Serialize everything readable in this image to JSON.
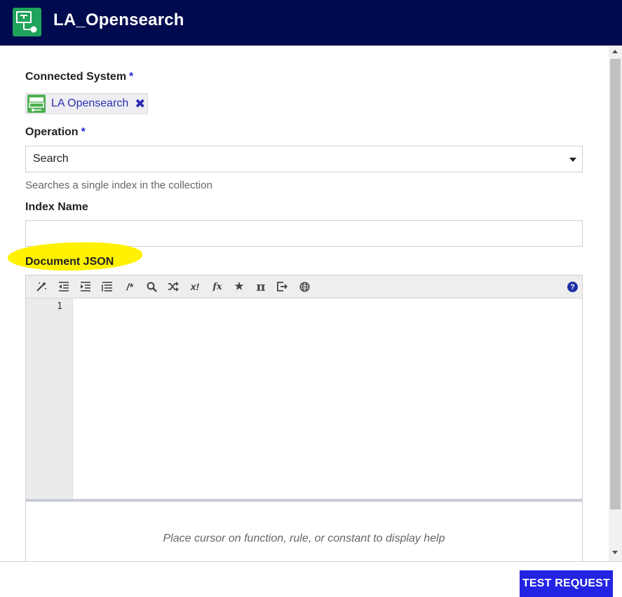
{
  "header": {
    "title": "LA_Opensearch"
  },
  "form": {
    "connected_system": {
      "label": "Connected System",
      "required_mark": "*",
      "chip_label": "LA Opensearch",
      "remove_glyph": "✖"
    },
    "operation": {
      "label": "Operation",
      "required_mark": "*",
      "selected": "Search",
      "description": "Searches a single index in the collection"
    },
    "index_name": {
      "label": "Index Name",
      "value": ""
    },
    "document_json": {
      "label": "Document JSON",
      "toolbar": [
        {
          "name": "format-icon"
        },
        {
          "name": "outdent-icon"
        },
        {
          "name": "indent-icon"
        },
        {
          "name": "list-icon"
        },
        {
          "name": "comment-icon",
          "glyph": "/*"
        },
        {
          "name": "search-icon"
        },
        {
          "name": "shuffle-icon"
        },
        {
          "name": "test-icon",
          "glyph": "x!"
        },
        {
          "name": "function-icon",
          "glyph": "fx"
        },
        {
          "name": "star-icon",
          "glyph": "★"
        },
        {
          "name": "pi-icon",
          "glyph": "π"
        },
        {
          "name": "export-icon"
        },
        {
          "name": "globe-icon"
        }
      ],
      "help_glyph": "?",
      "line_numbers": [
        "1"
      ],
      "help_message": "Place cursor on function, rule, or constant to display help"
    }
  },
  "footer": {
    "test_request_label": "TEST REQUEST"
  },
  "colors": {
    "header_bg": "#000a4f",
    "accent": "#2323e3",
    "logo_green": "#1fa35a",
    "highlight": "#fff200"
  }
}
